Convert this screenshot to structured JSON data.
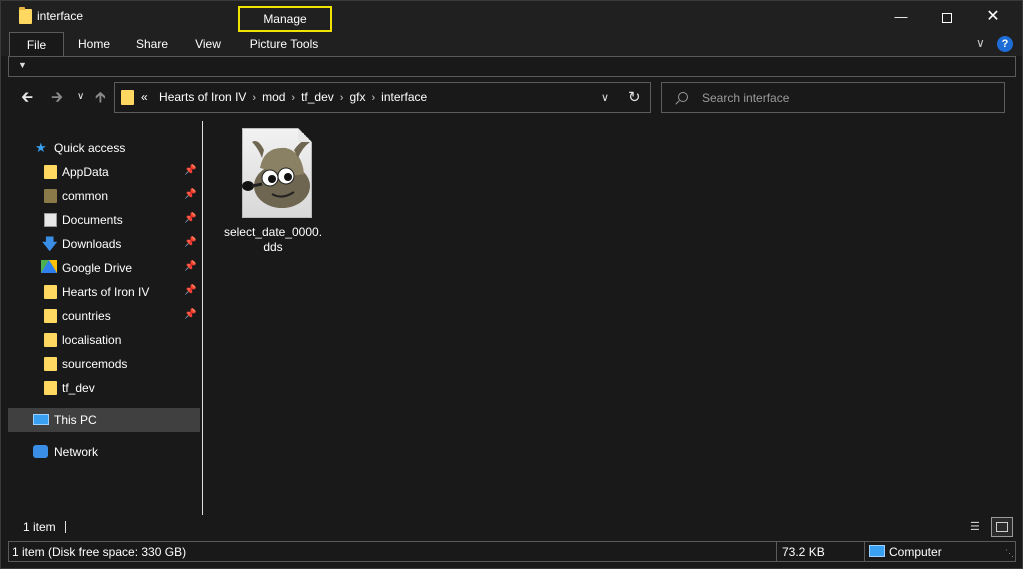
{
  "window": {
    "title": "interface",
    "manage_tab": "Manage",
    "minimize_glyph": "—",
    "close_glyph": "✕"
  },
  "ribbon": {
    "tabs": [
      "File",
      "Home",
      "Share",
      "View",
      "Picture Tools"
    ],
    "help_glyph": "?"
  },
  "address": {
    "overflow": "«",
    "crumbs": [
      "Hearts of Iron IV",
      "mod",
      "tf_dev",
      "gfx",
      "interface"
    ]
  },
  "search": {
    "placeholder": "Search interface"
  },
  "sidebar": {
    "quick_access": "Quick access",
    "items": [
      {
        "label": "AppData",
        "icon": "folder-icon",
        "pinned": true
      },
      {
        "label": "common",
        "icon": "folder-icon",
        "pinned": true
      },
      {
        "label": "Documents",
        "icon": "documents-icon",
        "pinned": true
      },
      {
        "label": "Downloads",
        "icon": "download-icon",
        "pinned": true
      },
      {
        "label": "Google Drive",
        "icon": "google-drive-icon",
        "pinned": true
      },
      {
        "label": "Hearts of Iron IV",
        "icon": "folder-icon",
        "pinned": true
      },
      {
        "label": "countries",
        "icon": "folder-icon",
        "pinned": true
      },
      {
        "label": "localisation",
        "icon": "folder-icon",
        "pinned": false
      },
      {
        "label": "sourcemods",
        "icon": "folder-icon",
        "pinned": false
      },
      {
        "label": "tf_dev",
        "icon": "folder-icon",
        "pinned": false
      }
    ],
    "this_pc": "This PC",
    "network": "Network"
  },
  "content": {
    "files": [
      {
        "name": "select_date_0000.dds",
        "icon": "gimp-file-icon"
      }
    ]
  },
  "status": {
    "item_count": "1 item",
    "details": "1 item (Disk free space: 330 GB)",
    "size": "73.2 KB",
    "location": "Computer"
  },
  "colors": {
    "background": "#191919",
    "folder": "#ffd861",
    "accent": "#3aa0f2",
    "manage_highlight": "#f2e400"
  }
}
